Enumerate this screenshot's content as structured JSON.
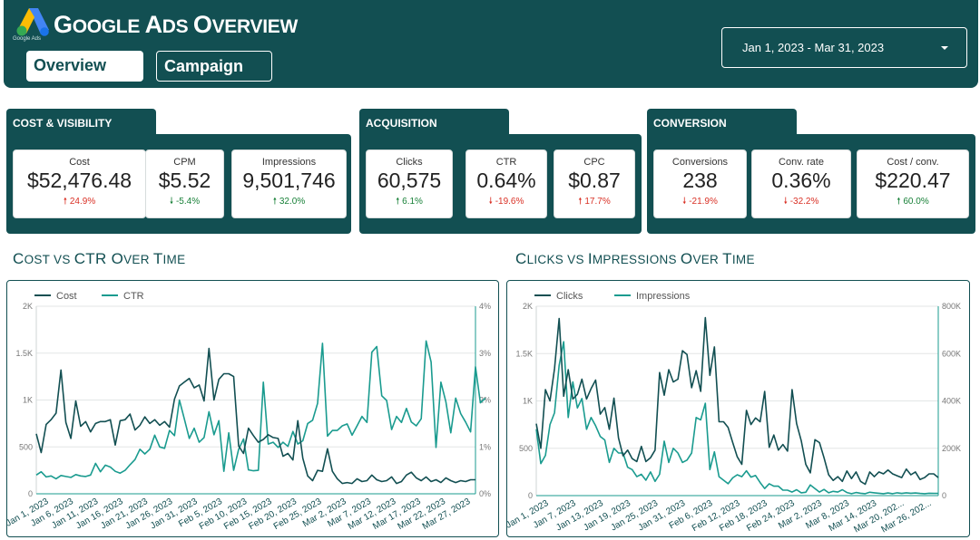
{
  "header": {
    "logo_text": "Google Ads",
    "title": "Google Ads Overview",
    "title_parts": [
      "G",
      "OOGLE ",
      "A",
      "DS ",
      "O",
      "VERVIEW"
    ]
  },
  "nav": {
    "overview_label": "Overview",
    "campaign_label": "Campaign"
  },
  "date_range": "Jan 1, 2023 - Mar 31, 2023",
  "sections": [
    {
      "title": "COST & VISIBILITY",
      "kpis": [
        {
          "label": "Cost",
          "value": "$52,476.48",
          "delta": "24.9%",
          "direction": "up",
          "tone": "bad"
        },
        {
          "label": "CPM",
          "value": "$5.52",
          "delta": "-5.4%",
          "direction": "down",
          "tone": "good"
        },
        {
          "label": "Impressions",
          "value": "9,501,746",
          "delta": "32.0%",
          "direction": "up",
          "tone": "good"
        }
      ]
    },
    {
      "title": "ACQUISITION",
      "kpis": [
        {
          "label": "Clicks",
          "value": "60,575",
          "delta": "6.1%",
          "direction": "up",
          "tone": "good"
        },
        {
          "label": "CTR",
          "value": "0.64%",
          "delta": "-19.6%",
          "direction": "down",
          "tone": "bad"
        },
        {
          "label": "CPC",
          "value": "$0.87",
          "delta": "17.7%",
          "direction": "up",
          "tone": "bad"
        }
      ]
    },
    {
      "title": "CONVERSION",
      "kpis": [
        {
          "label": "Conversions",
          "value": "238",
          "delta": "-21.9%",
          "direction": "down",
          "tone": "bad"
        },
        {
          "label": "Conv. rate",
          "value": "0.36%",
          "delta": "-32.2%",
          "direction": "down",
          "tone": "bad"
        },
        {
          "label": "Cost / conv.",
          "value": "$220.47",
          "delta": "60.0%",
          "direction": "up",
          "tone": "good"
        }
      ]
    }
  ],
  "colors": {
    "brand": "#124f52",
    "series_primary": "#124f52",
    "series_secondary": "#1a9b8f",
    "bad": "#d93025",
    "good": "#188038"
  },
  "chart_data": [
    {
      "type": "line",
      "title": "Cost vs CTR Over Time",
      "title_parts": [
        "C",
        "OST VS ",
        "CTR O",
        "VER ",
        "T",
        "IME"
      ],
      "y_left_ticks": [
        "0",
        "500",
        "1K",
        "1.5K",
        "2K"
      ],
      "y_right_ticks": [
        "0%",
        "1%",
        "2%",
        "3%",
        "4%"
      ],
      "ylim_left": [
        0,
        2000
      ],
      "ylim_right": [
        0,
        4
      ],
      "x_tick_labels": [
        "Jan 1, 2023",
        "Jan 6, 2023",
        "Jan 11, 2023",
        "Jan 16, 2023",
        "Jan 21, 2023",
        "Jan 26, 2023",
        "Jan 31, 2023",
        "Feb 5, 2023",
        "Feb 10, 2023",
        "Feb 15, 2023",
        "Feb 20, 2023",
        "Feb 25, 2023",
        "Mar 2, 2023",
        "Mar 7, 2023",
        "Mar 12, 2023",
        "Mar 17, 2023",
        "Mar 22, 2023",
        "Mar 27, 2023"
      ],
      "series": [
        {
          "name": "Cost",
          "axis": "left",
          "values": [
            640,
            440,
            740,
            790,
            860,
            1320,
            760,
            590,
            990,
            720,
            770,
            660,
            750,
            770,
            770,
            790,
            520,
            780,
            790,
            850,
            680,
            730,
            820,
            750,
            790,
            730,
            770,
            710,
            1010,
            1150,
            1190,
            1230,
            1130,
            1160,
            990,
            1550,
            1000,
            1220,
            1280,
            1280,
            1250,
            510,
            430,
            700,
            620,
            550,
            580,
            630,
            600,
            590,
            400,
            430,
            360,
            780,
            380,
            190,
            140,
            250,
            240,
            480,
            240,
            160,
            110,
            120,
            110,
            160,
            130,
            140,
            200,
            150,
            130,
            140,
            180,
            110,
            130,
            200,
            230,
            170,
            140,
            180,
            130,
            150,
            120,
            170,
            140,
            120,
            140,
            130,
            150,
            150
          ]
        },
        {
          "name": "CTR",
          "axis": "right",
          "values": [
            0.4,
            0.47,
            0.36,
            0.38,
            0.32,
            0.39,
            0.37,
            0.35,
            0.41,
            0.38,
            0.37,
            0.4,
            0.65,
            0.47,
            0.61,
            0.57,
            0.48,
            0.44,
            0.5,
            0.62,
            0.73,
            0.95,
            0.85,
            0.95,
            1.25,
            1.0,
            0.97,
            1.35,
            1.24,
            2.0,
            1.6,
            1.18,
            1.4,
            1.1,
            1.2,
            1.75,
            1.26,
            1.56,
            0.48,
            1.3,
            0.5,
            0.95,
            1.17,
            0.51,
            0.49,
            0.5,
            2.38,
            1.06,
            1.1,
            0.99,
            1.1,
            1.01,
            1.33,
            1.06,
            1.13,
            1.5,
            1.57,
            1.93,
            3.21,
            1.23,
            1.35,
            1.35,
            1.45,
            1.49,
            1.25,
            1.45,
            1.65,
            1.52,
            3.02,
            3.14,
            2.09,
            1.99,
            1.37,
            1.65,
            1.52,
            1.82,
            1.53,
            1.45,
            1.6,
            3.26,
            2.81,
            0.99,
            2.38,
            1.96,
            1.3,
            2.04,
            1.71,
            1.53,
            1.32,
            2.71,
            1.94,
            2.04
          ]
        }
      ],
      "legend": "top-left",
      "grid": "horizontal"
    },
    {
      "type": "line",
      "title": "Clicks vs Impressions Over Time",
      "title_parts": [
        "C",
        "LICKS VS ",
        "I",
        "MPRESSIONS ",
        "O",
        "VER ",
        "T",
        "IME"
      ],
      "y_left_ticks": [
        "0",
        "500",
        "1K",
        "1.5K",
        "2K"
      ],
      "y_right_ticks": [
        "0",
        "200K",
        "400K",
        "600K",
        "800K"
      ],
      "ylim_left": [
        0,
        2000
      ],
      "ylim_right": [
        0,
        800000
      ],
      "x_tick_labels": [
        "Jan 1, 2023",
        "Jan 7, 2023",
        "Jan 13, 2023",
        "Jan 19, 2023",
        "Jan 25, 2023",
        "Jan 31, 2023",
        "Feb 6, 2023",
        "Feb 12, 2023",
        "Feb 18, 2023",
        "Feb 24, 2023",
        "Mar 2, 2023",
        "Mar 8, 2023",
        "Mar 14, 2023",
        "Mar 20, 202...",
        "Mar 26, 202..."
      ],
      "series": [
        {
          "name": "Clicks",
          "axis": "left",
          "values": [
            760,
            500,
            1120,
            1000,
            1340,
            1870,
            1050,
            1330,
            1020,
            1070,
            1230,
            1020,
            1130,
            1220,
            860,
            930,
            700,
            1030,
            610,
            420,
            480,
            390,
            360,
            520,
            360,
            400,
            480,
            1300,
            1060,
            1330,
            1200,
            1230,
            1530,
            1490,
            1140,
            1320,
            1100,
            1880,
            1270,
            1570,
            780,
            780,
            720,
            560,
            410,
            330,
            900,
            750,
            820,
            780,
            1100,
            510,
            640,
            480,
            540,
            470,
            1120,
            760,
            580,
            330,
            240,
            590,
            560,
            400,
            220,
            160,
            200,
            150,
            260,
            180,
            250,
            150,
            120,
            250,
            200,
            250,
            230,
            270,
            230,
            210,
            190,
            280,
            220,
            250,
            170,
            190,
            230,
            230,
            190
          ]
        },
        {
          "name": "Impressions",
          "axis": "right",
          "values": [
            280000,
            135000,
            170000,
            300000,
            350000,
            550000,
            650000,
            330000,
            480000,
            370000,
            410000,
            280000,
            330000,
            295000,
            250000,
            235000,
            140000,
            200000,
            180000,
            180000,
            120000,
            110000,
            80000,
            90000,
            65000,
            100000,
            60000,
            90000,
            230000,
            140000,
            200000,
            180000,
            140000,
            150000,
            180000,
            330000,
            320000,
            390000,
            110000,
            185000,
            80000,
            65000,
            50000,
            75000,
            88000,
            80000,
            105000,
            78000,
            85000,
            55000,
            30000,
            50000,
            40000,
            40000,
            23000,
            23000,
            15000,
            25000,
            12000,
            14000,
            45000,
            30000,
            15000,
            26000,
            12000,
            18000,
            15000,
            25000,
            13000,
            8000,
            13000,
            10000,
            8000,
            14000,
            12000,
            10000,
            8000,
            11000,
            8000,
            12000,
            9000,
            12000,
            10000,
            11000,
            9000,
            8000,
            10000,
            9000,
            9000
          ]
        }
      ],
      "legend": "top-left",
      "grid": "horizontal"
    }
  ]
}
